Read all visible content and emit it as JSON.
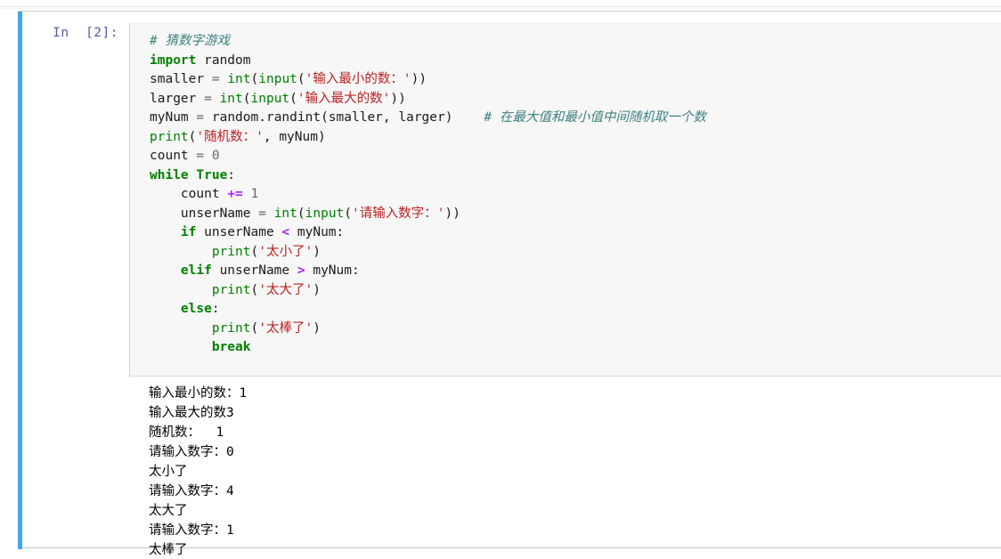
{
  "notebook": {
    "cell": {
      "prompt_label": "In  [2]:",
      "execution_count": "2",
      "selected": true,
      "selection_bar_color": "#42a5f5",
      "input_background": "#f7f7f7",
      "output_background": "#ffffff"
    },
    "colors": {
      "comment": "#408080",
      "keyword": "#008000",
      "builtin": "#008000",
      "string": "#ba2121",
      "operator": "#aa22ff",
      "text": "#1a1a1a",
      "prompt": "#303f9f"
    },
    "source_lines": [
      [
        {
          "t": "comment",
          "s": "# 猜数字游戏"
        }
      ],
      [
        {
          "t": "keyword",
          "s": "import"
        },
        {
          "t": "plain",
          "s": " random"
        }
      ],
      [
        {
          "t": "plain",
          "s": "smaller "
        },
        {
          "t": "operator",
          "s": "="
        },
        {
          "t": "plain",
          "s": " "
        },
        {
          "t": "builtin",
          "s": "int"
        },
        {
          "t": "plain",
          "s": "("
        },
        {
          "t": "builtin",
          "s": "input"
        },
        {
          "t": "plain",
          "s": "("
        },
        {
          "t": "string",
          "s": "'输入最小的数：'"
        },
        {
          "t": "plain",
          "s": "))"
        }
      ],
      [
        {
          "t": "plain",
          "s": "larger "
        },
        {
          "t": "operator",
          "s": "="
        },
        {
          "t": "plain",
          "s": " "
        },
        {
          "t": "builtin",
          "s": "int"
        },
        {
          "t": "plain",
          "s": "("
        },
        {
          "t": "builtin",
          "s": "input"
        },
        {
          "t": "plain",
          "s": "("
        },
        {
          "t": "string",
          "s": "'输入最大的数'"
        },
        {
          "t": "plain",
          "s": "))"
        }
      ],
      [
        {
          "t": "plain",
          "s": "myNum "
        },
        {
          "t": "operator",
          "s": "="
        },
        {
          "t": "plain",
          "s": " random.randint(smaller, larger)    "
        },
        {
          "t": "comment",
          "s": "# 在最大值和最小值中间随机取一个数"
        }
      ],
      [
        {
          "t": "builtin",
          "s": "print"
        },
        {
          "t": "plain",
          "s": "("
        },
        {
          "t": "string",
          "s": "'随机数：'"
        },
        {
          "t": "plain",
          "s": ", myNum)"
        }
      ],
      [
        {
          "t": "plain",
          "s": "count "
        },
        {
          "t": "operator",
          "s": "="
        },
        {
          "t": "plain",
          "s": " "
        },
        {
          "t": "number",
          "s": "0"
        }
      ],
      [
        {
          "t": "keyword",
          "s": "while"
        },
        {
          "t": "plain",
          "s": " "
        },
        {
          "t": "keyword",
          "s": "True"
        },
        {
          "t": "plain",
          "s": ":"
        }
      ],
      [
        {
          "t": "plain",
          "s": "    count "
        },
        {
          "t": "oppunct",
          "s": "+="
        },
        {
          "t": "plain",
          "s": " "
        },
        {
          "t": "number",
          "s": "1"
        }
      ],
      [
        {
          "t": "plain",
          "s": "    unserName "
        },
        {
          "t": "operator",
          "s": "="
        },
        {
          "t": "plain",
          "s": " "
        },
        {
          "t": "builtin",
          "s": "int"
        },
        {
          "t": "plain",
          "s": "("
        },
        {
          "t": "builtin",
          "s": "input"
        },
        {
          "t": "plain",
          "s": "("
        },
        {
          "t": "string",
          "s": "'请输入数字：'"
        },
        {
          "t": "plain",
          "s": "))"
        }
      ],
      [
        {
          "t": "plain",
          "s": "    "
        },
        {
          "t": "keyword",
          "s": "if"
        },
        {
          "t": "plain",
          "s": " unserName "
        },
        {
          "t": "oppunct",
          "s": "<"
        },
        {
          "t": "plain",
          "s": " myNum:"
        }
      ],
      [
        {
          "t": "plain",
          "s": "        "
        },
        {
          "t": "builtin",
          "s": "print"
        },
        {
          "t": "plain",
          "s": "("
        },
        {
          "t": "string",
          "s": "'太小了'"
        },
        {
          "t": "plain",
          "s": ")"
        }
      ],
      [
        {
          "t": "plain",
          "s": "    "
        },
        {
          "t": "keyword",
          "s": "elif"
        },
        {
          "t": "plain",
          "s": " unserName "
        },
        {
          "t": "oppunct",
          "s": ">"
        },
        {
          "t": "plain",
          "s": " myNum:"
        }
      ],
      [
        {
          "t": "plain",
          "s": "        "
        },
        {
          "t": "builtin",
          "s": "print"
        },
        {
          "t": "plain",
          "s": "("
        },
        {
          "t": "string",
          "s": "'太大了'"
        },
        {
          "t": "plain",
          "s": ")"
        }
      ],
      [
        {
          "t": "plain",
          "s": "    "
        },
        {
          "t": "keyword",
          "s": "else"
        },
        {
          "t": "plain",
          "s": ":"
        }
      ],
      [
        {
          "t": "plain",
          "s": "        "
        },
        {
          "t": "builtin",
          "s": "print"
        },
        {
          "t": "plain",
          "s": "("
        },
        {
          "t": "string",
          "s": "'太棒了'"
        },
        {
          "t": "plain",
          "s": ")"
        }
      ],
      [
        {
          "t": "plain",
          "s": "        "
        },
        {
          "t": "keyword",
          "s": "break"
        }
      ]
    ],
    "output_lines": [
      "输入最小的数：1",
      "输入最大的数3",
      "随机数：  1",
      "请输入数字：0",
      "太小了",
      "请输入数字：4",
      "太大了",
      "请输入数字：1",
      "太棒了"
    ]
  }
}
